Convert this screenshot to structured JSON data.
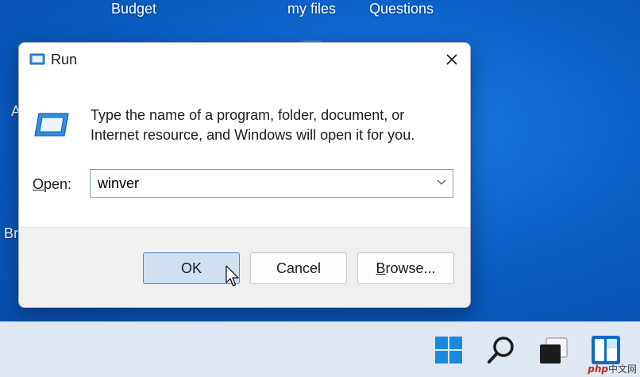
{
  "desktop": {
    "labels": [
      "Budget",
      "my files",
      "Questions"
    ],
    "partial_labels": [
      "A",
      "Bri"
    ]
  },
  "dialog": {
    "title": "Run",
    "description_line1": "Type the name of a program, folder, document, or",
    "description_line2": "Internet resource, and Windows will open it for you.",
    "open_label_mnemonic": "O",
    "open_label_rest": "pen:",
    "open_value": "winver",
    "buttons": {
      "ok": "OK",
      "cancel": "Cancel",
      "browse_mnemonic": "B",
      "browse_rest": "rowse..."
    }
  },
  "taskbar": {
    "icons": [
      "windows-start-icon",
      "search-icon",
      "task-view-icon",
      "widgets-icon"
    ]
  },
  "watermark": {
    "brand": "php",
    "site": "中文网"
  },
  "colors": {
    "desktop_blue": "#0a5dc3",
    "taskbar": "#dfe7f3",
    "accent": "#4f86c9",
    "ok_fill": "#cfe0f0"
  }
}
